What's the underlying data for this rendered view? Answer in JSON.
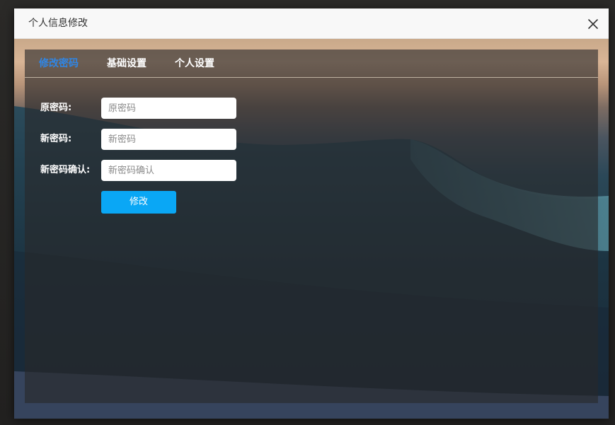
{
  "dialog": {
    "title": "个人信息修改",
    "close_icon": "close-icon"
  },
  "tabs": [
    {
      "label": "修改密码",
      "active": true
    },
    {
      "label": "基础设置",
      "active": false
    },
    {
      "label": "个人设置",
      "active": false
    }
  ],
  "form": {
    "fields": [
      {
        "label": "原密码:",
        "placeholder": "原密码",
        "value": ""
      },
      {
        "label": "新密码:",
        "placeholder": "新密码",
        "value": ""
      },
      {
        "label": "新密码确认:",
        "placeholder": "新密码确认",
        "value": ""
      }
    ],
    "submit_label": "修改"
  },
  "colors": {
    "active_tab": "#2f86e6",
    "primary_button": "#0aa7f5"
  }
}
